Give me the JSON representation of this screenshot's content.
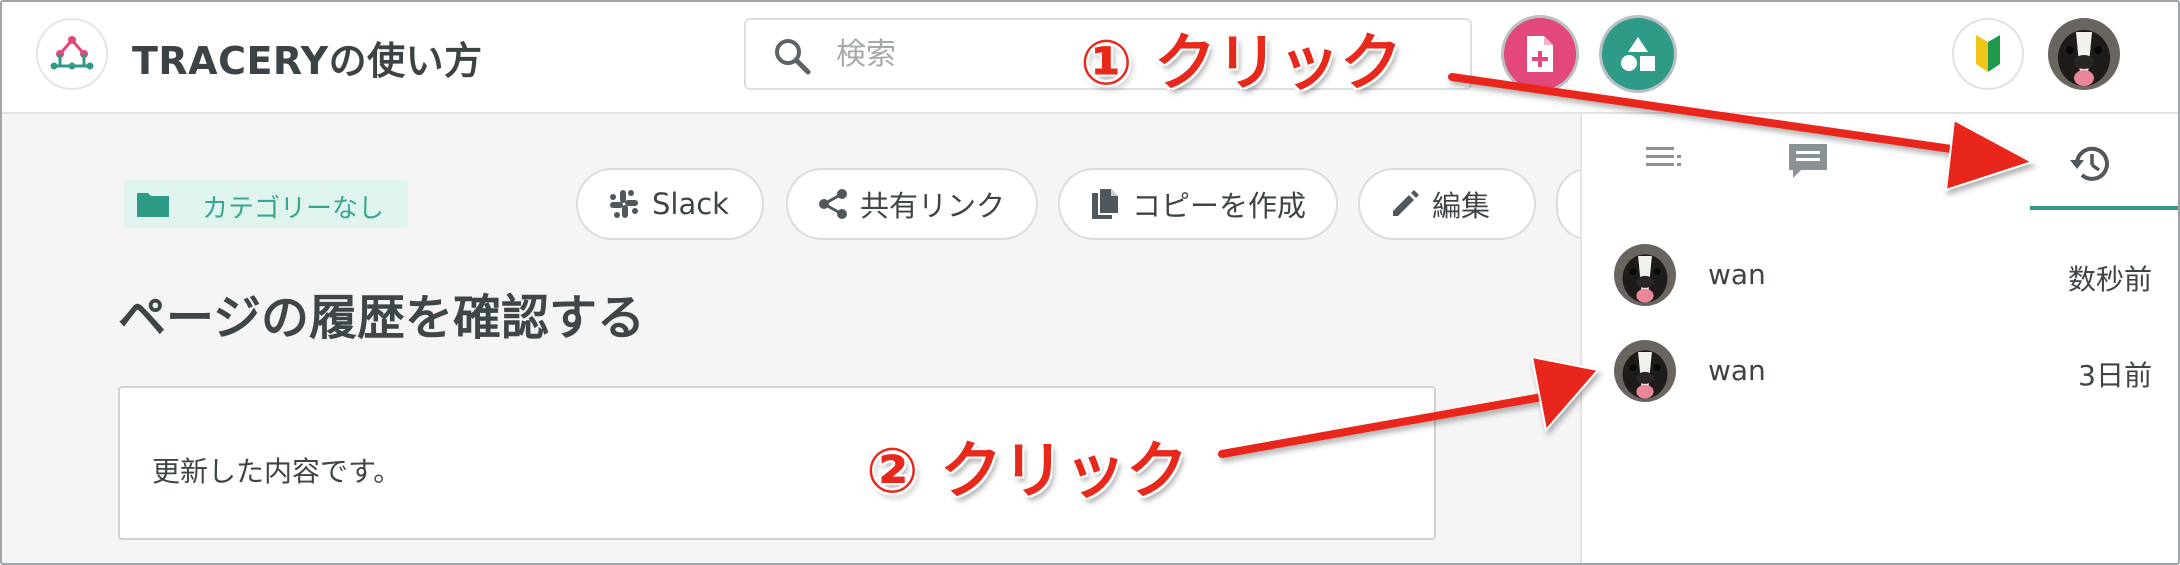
{
  "header": {
    "app_title": "TRACERYの使い方",
    "search_placeholder": "検索",
    "new_page_icon": "file-plus-icon",
    "templates_icon": "shapes-icon",
    "beginner_icon": "beginner-mark-icon"
  },
  "main": {
    "category_label": "カテゴリーなし",
    "actions": {
      "slack_label": "Slack",
      "share_label": "共有リンク",
      "copy_label": "コピーを作成",
      "edit_label": "編集"
    },
    "page_title": "ページの履歴を確認する",
    "content_text": "更新した内容です。"
  },
  "panel": {
    "history": [
      {
        "user": "wan",
        "time": "数秒前"
      },
      {
        "user": "wan",
        "time": "3日前"
      }
    ]
  },
  "annotations": {
    "step1": "① クリック",
    "step2": "② クリック",
    "color": "#e8281b"
  },
  "colors": {
    "accent": "#2f9a86",
    "new_page": "#e2487a",
    "category_bg": "#dff3ef",
    "category_text": "#3aa68f"
  }
}
